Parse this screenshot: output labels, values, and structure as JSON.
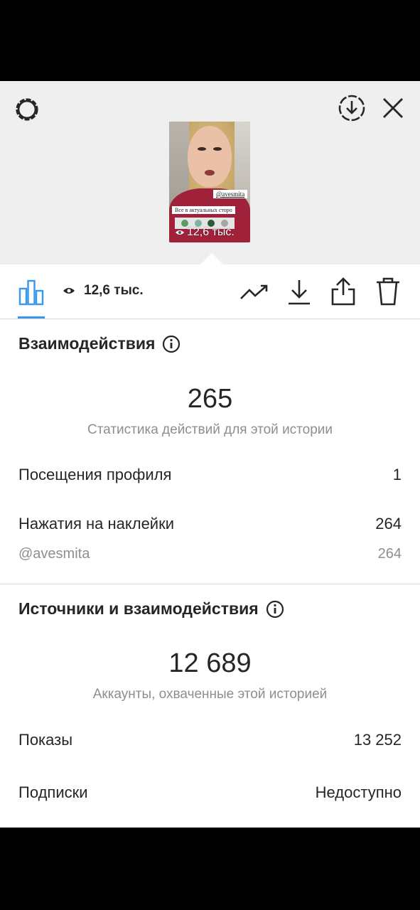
{
  "story_preview": {
    "tag": "@avesmita",
    "caption": "Все в актуальных сторо",
    "views": "12,6 тыс."
  },
  "toolbar": {
    "views": "12,6 тыс."
  },
  "interactions": {
    "title": "Взаимодействия",
    "total": "265",
    "subtitle": "Статистика действий для этой истории",
    "rows": [
      {
        "label": "Посещения профиля",
        "value": "1"
      },
      {
        "label": "Нажатия на наклейки",
        "value": "264"
      }
    ],
    "sub_row": {
      "label": "@avesmita",
      "value": "264"
    }
  },
  "reach": {
    "title": "Источники и взаимодействия",
    "total": "12 689",
    "subtitle": "Аккаунты, охваченные этой историей",
    "rows": [
      {
        "label": "Показы",
        "value": "13 252"
      },
      {
        "label": "Подписки",
        "value": "Недоступно"
      }
    ]
  },
  "colors": {
    "accent": "#3897f0",
    "text": "#262626",
    "secondary": "#8e8e8e",
    "preview_bg": "#efefef"
  },
  "icons": [
    "settings-icon",
    "download-circle-icon",
    "close-icon",
    "bar-chart-icon",
    "eye-icon",
    "trend-icon",
    "download-icon",
    "share-icon",
    "trash-icon",
    "info-icon"
  ]
}
